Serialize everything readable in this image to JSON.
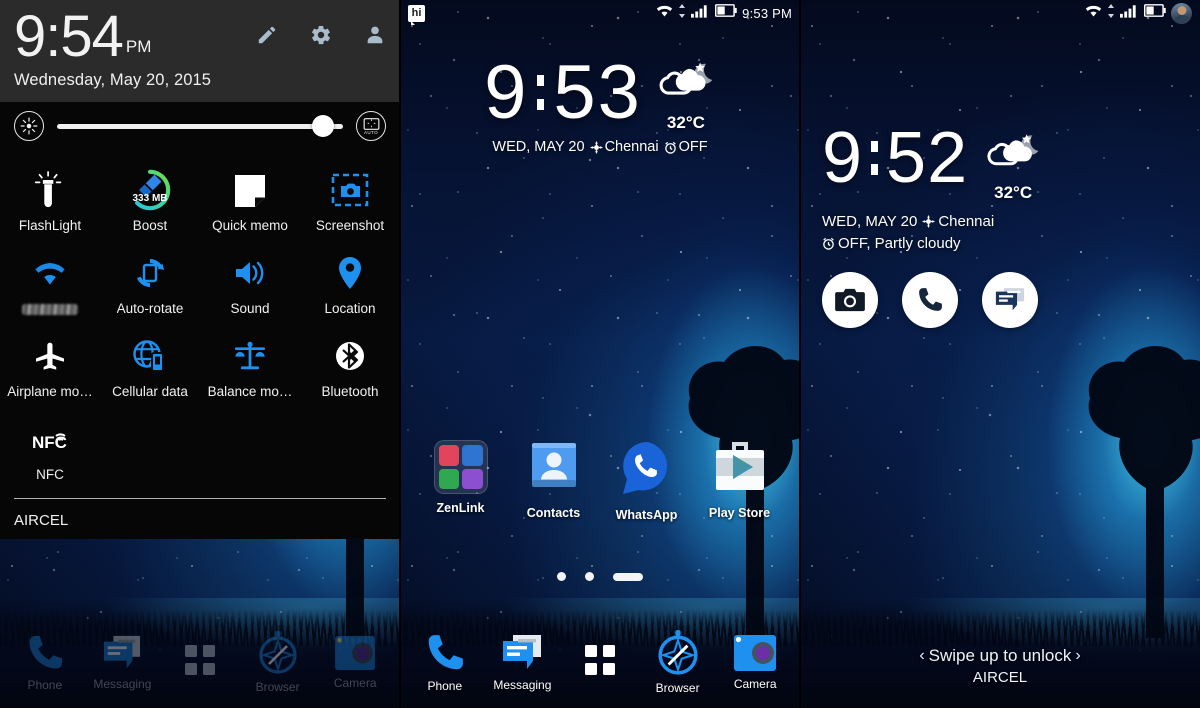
{
  "panel1": {
    "name": "Quick settings shade",
    "clock": {
      "time": "9:54",
      "ampm": "PM"
    },
    "date": "Wednesday, May 20, 2015",
    "header_icons": [
      {
        "name": "edit-pencil-icon",
        "label": "Edit"
      },
      {
        "name": "settings-gear-icon",
        "label": "Settings"
      },
      {
        "name": "user-profile-icon",
        "label": "User"
      }
    ],
    "brightness": {
      "icon_label": "Brightness",
      "value_percent": 93,
      "auto_label": "AUTO"
    },
    "tiles": [
      {
        "label": "FlashLight",
        "icon": "flashlight-icon",
        "state": "off"
      },
      {
        "label": "Boost",
        "icon": "boost-broom-icon",
        "badge": "333 MB",
        "state": "on"
      },
      {
        "label": "Quick memo",
        "icon": "quick-memo-icon",
        "state": "off"
      },
      {
        "label": "Screenshot",
        "icon": "screenshot-icon",
        "state": "off"
      },
      {
        "label": "",
        "icon": "wifi-icon",
        "state": "on",
        "redacted": true
      },
      {
        "label": "Auto-rotate",
        "icon": "auto-rotate-icon",
        "state": "on"
      },
      {
        "label": "Sound",
        "icon": "sound-speaker-icon",
        "state": "on"
      },
      {
        "label": "Location",
        "icon": "location-pin-icon",
        "state": "on"
      },
      {
        "label": "Airplane mo…",
        "icon": "airplane-icon",
        "state": "off"
      },
      {
        "label": "Cellular data",
        "icon": "cellular-data-icon",
        "state": "on"
      },
      {
        "label": "Balance mo…",
        "icon": "balance-scale-icon",
        "state": "on"
      },
      {
        "label": "Bluetooth",
        "icon": "bluetooth-icon",
        "state": "off"
      },
      {
        "label": "NFC",
        "icon": "nfc-icon",
        "state": "off"
      }
    ],
    "carrier": "AIRCEL",
    "dock": [
      {
        "label": "Phone",
        "icon": "phone-icon"
      },
      {
        "label": "Messaging",
        "icon": "messaging-icon"
      },
      {
        "label": "",
        "icon": "app-drawer-icon"
      },
      {
        "label": "Browser",
        "icon": "browser-compass-icon"
      },
      {
        "label": "Camera",
        "icon": "camera-icon"
      }
    ]
  },
  "panel2": {
    "name": "Home screen",
    "statusbar": {
      "notification_icon": "hike-messenger-icon",
      "notification_text": "hi",
      "icons": [
        "wifi-icon",
        "data-transfer-icon",
        "signal-bars-icon",
        "battery-icon"
      ],
      "time": "9:53 PM"
    },
    "clock": {
      "time_hour": "9",
      "time_min": "53"
    },
    "weather": {
      "temp": "32°C",
      "icon": "partly-cloudy-night-icon"
    },
    "subline": {
      "date": "WED, MAY 20",
      "location": "Chennai",
      "alarm": "OFF"
    },
    "apps": [
      {
        "label": "ZenLink",
        "icon": "zenlink-folder-icon"
      },
      {
        "label": "Contacts",
        "icon": "contacts-icon"
      },
      {
        "label": "WhatsApp",
        "icon": "whatsapp-icon"
      },
      {
        "label": "Play Store",
        "icon": "play-store-icon"
      }
    ],
    "page_indicator": {
      "pages": 3,
      "active": 3
    },
    "dock": [
      {
        "label": "Phone",
        "icon": "phone-icon"
      },
      {
        "label": "Messaging",
        "icon": "messaging-icon"
      },
      {
        "label": "",
        "icon": "app-drawer-icon"
      },
      {
        "label": "Browser",
        "icon": "browser-compass-icon"
      },
      {
        "label": "Camera",
        "icon": "camera-icon"
      }
    ]
  },
  "panel3": {
    "name": "Lock screen",
    "statusbar": {
      "icons": [
        "wifi-icon",
        "data-transfer-icon",
        "signal-bars-icon",
        "battery-icon"
      ],
      "avatar": "user-avatar-photo"
    },
    "clock": {
      "time_hour": "9",
      "time_min": "52"
    },
    "weather": {
      "temp": "32°C",
      "icon": "partly-cloudy-night-icon"
    },
    "subline": {
      "line1_date": "WED, MAY 20",
      "line1_location": "Chennai",
      "line2": "OFF, Partly cloudy"
    },
    "shortcuts": [
      {
        "label": "Camera",
        "icon": "camera-icon"
      },
      {
        "label": "Phone",
        "icon": "phone-icon"
      },
      {
        "label": "Messaging",
        "icon": "messaging-icon"
      }
    ],
    "unlock_text": "Swipe up to unlock",
    "carrier": "AIRCEL",
    "chevron_left": "‹",
    "chevron_right": "›"
  },
  "colors": {
    "accent_blue": "#1e90f0",
    "shade_header": "#2b2b2b",
    "shade_body": "#0b0b0b",
    "boost_ring_start": "#2bc4d8",
    "boost_ring_end": "#6fd84a",
    "text_primary": "#f2f2f2"
  }
}
